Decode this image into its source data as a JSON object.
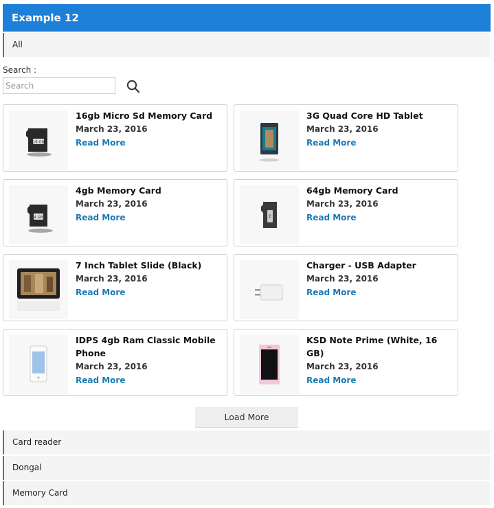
{
  "header": {
    "title": "Example 12"
  },
  "filters": {
    "all": "All"
  },
  "search": {
    "label": "Search :",
    "placeholder": "Search"
  },
  "date": "March 23, 2016",
  "read_more": "Read More",
  "items": [
    {
      "title": "16gb Micro Sd Memory Card",
      "icon": "microsd-card"
    },
    {
      "title": "3G Quad Core HD Tablet",
      "icon": "tablet"
    },
    {
      "title": "4gb Memory Card",
      "icon": "microsd-card"
    },
    {
      "title": "64gb Memory Card",
      "icon": "microsd-card"
    },
    {
      "title": "7 Inch Tablet Slide (Black)",
      "icon": "tablet"
    },
    {
      "title": "Charger - USB Adapter",
      "icon": "usb-charger"
    },
    {
      "title": "IDPS 4gb Ram Classic Mobile Phone",
      "icon": "mobile-phone"
    },
    {
      "title": "KSD Note Prime (White, 16 GB)",
      "icon": "mobile-phone"
    }
  ],
  "load_more": "Load More",
  "categories": [
    "Card reader",
    "Dongal",
    "Memory Card"
  ],
  "colors": {
    "header": "#1e7fd9",
    "link": "#1a7ab5"
  }
}
